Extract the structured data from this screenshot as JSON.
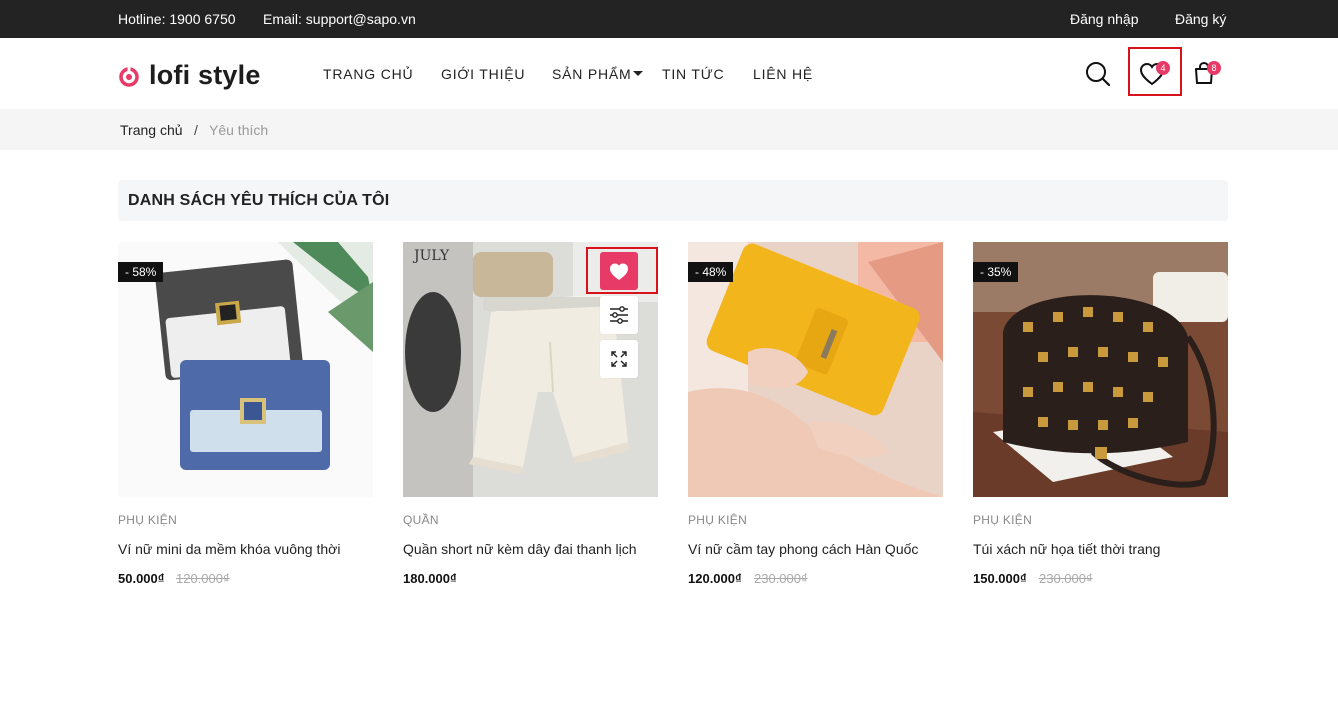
{
  "topbar": {
    "hotline": "Hotline: 1900 6750",
    "email": "Email: support@sapo.vn",
    "login": "Đăng nhập",
    "register": "Đăng ký"
  },
  "header": {
    "logo_text": "lofi style",
    "nav": [
      "TRANG CHỦ",
      "GIỚI THIỆU",
      "SẢN PHẨM",
      "TIN TỨC",
      "LIÊN HỆ"
    ],
    "wishlist_count": "4",
    "cart_count": "8"
  },
  "breadcrumb": {
    "home": "Trang chủ",
    "separator": "/",
    "current": "Yêu thích"
  },
  "page_title": "DANH SÁCH YÊU THÍCH CỦA TÔI",
  "products": [
    {
      "discount": "- 58%",
      "category": "PHỤ KIỆN",
      "name": "Ví nữ mini da mềm khóa vuông thời",
      "price": "50.000₫",
      "old_price": "120.000₫"
    },
    {
      "discount": "",
      "image_text": "JULY",
      "category": "QUẦN",
      "name": "Quần short nữ kèm dây đai thanh lịch",
      "price": "180.000₫",
      "old_price": ""
    },
    {
      "discount": "- 48%",
      "category": "PHỤ KIỆN",
      "name": "Ví nữ cầm tay phong cách Hàn Quốc",
      "price": "120.000₫",
      "old_price": "230.000₫"
    },
    {
      "discount": "- 35%",
      "category": "PHỤ KIỆN",
      "name": "Túi xách nữ họa tiết thời trang",
      "price": "150.000₫",
      "old_price": "230.000₫"
    }
  ],
  "colors": {
    "accent": "#e83a67",
    "topbar": "#232323",
    "highlight": "#d7121b"
  }
}
